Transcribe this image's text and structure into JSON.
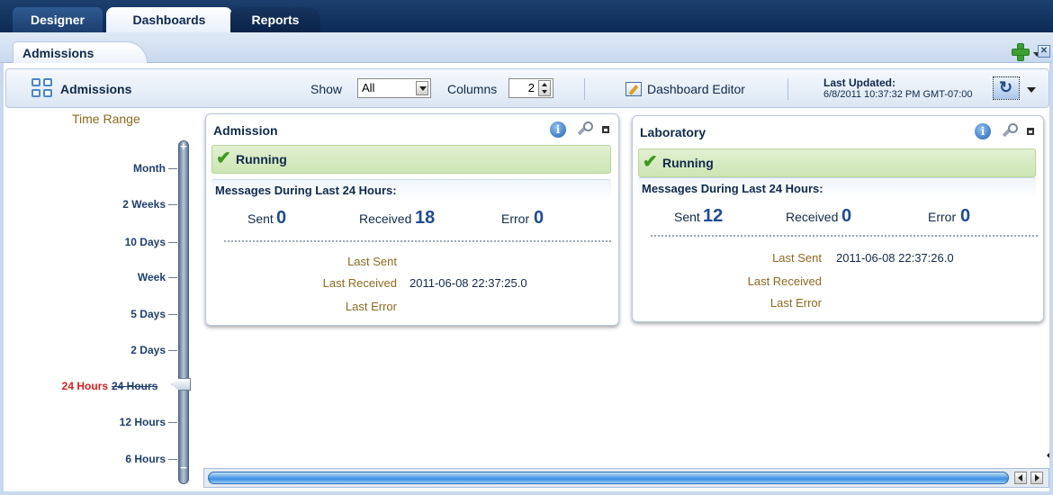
{
  "top_tabs": [
    {
      "label": "Designer"
    },
    {
      "label": "Dashboards"
    },
    {
      "label": "Reports"
    }
  ],
  "sub_tab": {
    "label": "Admissions"
  },
  "toolbar": {
    "title": "Admissions",
    "show_label": "Show",
    "show_value": "All",
    "columns_label": "Columns",
    "columns_value": "2",
    "editor_label": "Dashboard Editor",
    "last_updated_label": "Last Updated:",
    "last_updated_value": "6/8/2011 10:37:32 PM GMT-07:00"
  },
  "time_range": {
    "title": "Time Range",
    "ticks": [
      {
        "label": "Month"
      },
      {
        "label": "2 Weeks"
      },
      {
        "label": "10 Days"
      },
      {
        "label": "Week"
      },
      {
        "label": "5 Days"
      },
      {
        "label": "2 Days"
      },
      {
        "label": "24 Hours"
      },
      {
        "label": "12 Hours"
      },
      {
        "label": "6 Hours"
      }
    ],
    "selected": "24 Hours",
    "selected_mark": "24 Hours"
  },
  "cards": [
    {
      "title": "Admission",
      "status": "Running",
      "messages_title": "Messages During Last 24 Hours:",
      "sent_label": "Sent",
      "sent_value": "0",
      "received_label": "Received",
      "received_value": "18",
      "error_label": "Error",
      "error_value": "0",
      "last_sent_label": "Last Sent",
      "last_sent_value": "",
      "last_received_label": "Last Received",
      "last_received_value": "2011-06-08 22:37:25.0",
      "last_error_label": "Last Error",
      "last_error_value": ""
    },
    {
      "title": "Laboratory",
      "status": "Running",
      "messages_title": "Messages During Last 24 Hours:",
      "sent_label": "Sent",
      "sent_value": "12",
      "received_label": "Received",
      "received_value": "0",
      "error_label": "Error",
      "error_value": "0",
      "last_sent_label": "Last Sent",
      "last_sent_value": "2011-06-08 22:37:26.0",
      "last_received_label": "Last Received",
      "last_received_value": "",
      "last_error_label": "Last Error",
      "last_error_value": ""
    }
  ],
  "colors": {
    "header_navy": "#0d2b55",
    "accent_blue": "#1f4a97",
    "label_brown": "#8b6a1f",
    "selected_red": "#d61f1f",
    "running_green": "#cde5b4"
  }
}
